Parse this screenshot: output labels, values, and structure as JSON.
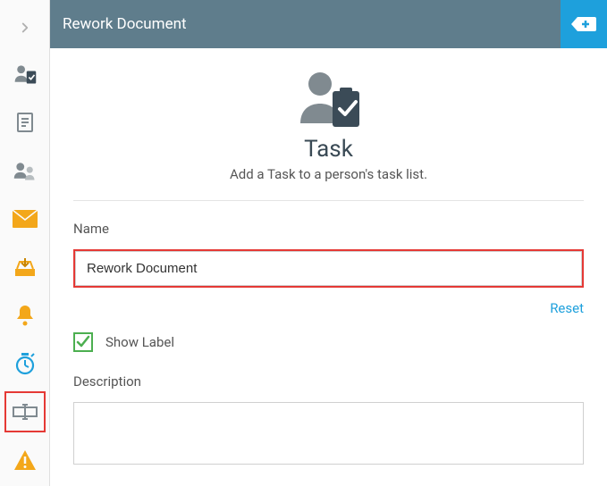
{
  "header": {
    "title": "Rework Document"
  },
  "hero": {
    "title": "Task",
    "subtitle": "Add a Task to a person's task list."
  },
  "form": {
    "name_label": "Name",
    "name_value": "Rework Document",
    "reset_label": "Reset",
    "show_label_checked": true,
    "show_label_text": "Show Label",
    "description_label": "Description",
    "description_value": ""
  },
  "colors": {
    "accent": "#1ea0dc",
    "header_bg": "#5f7d8c",
    "highlight_border": "#e53935",
    "check_green": "#4caf50"
  }
}
